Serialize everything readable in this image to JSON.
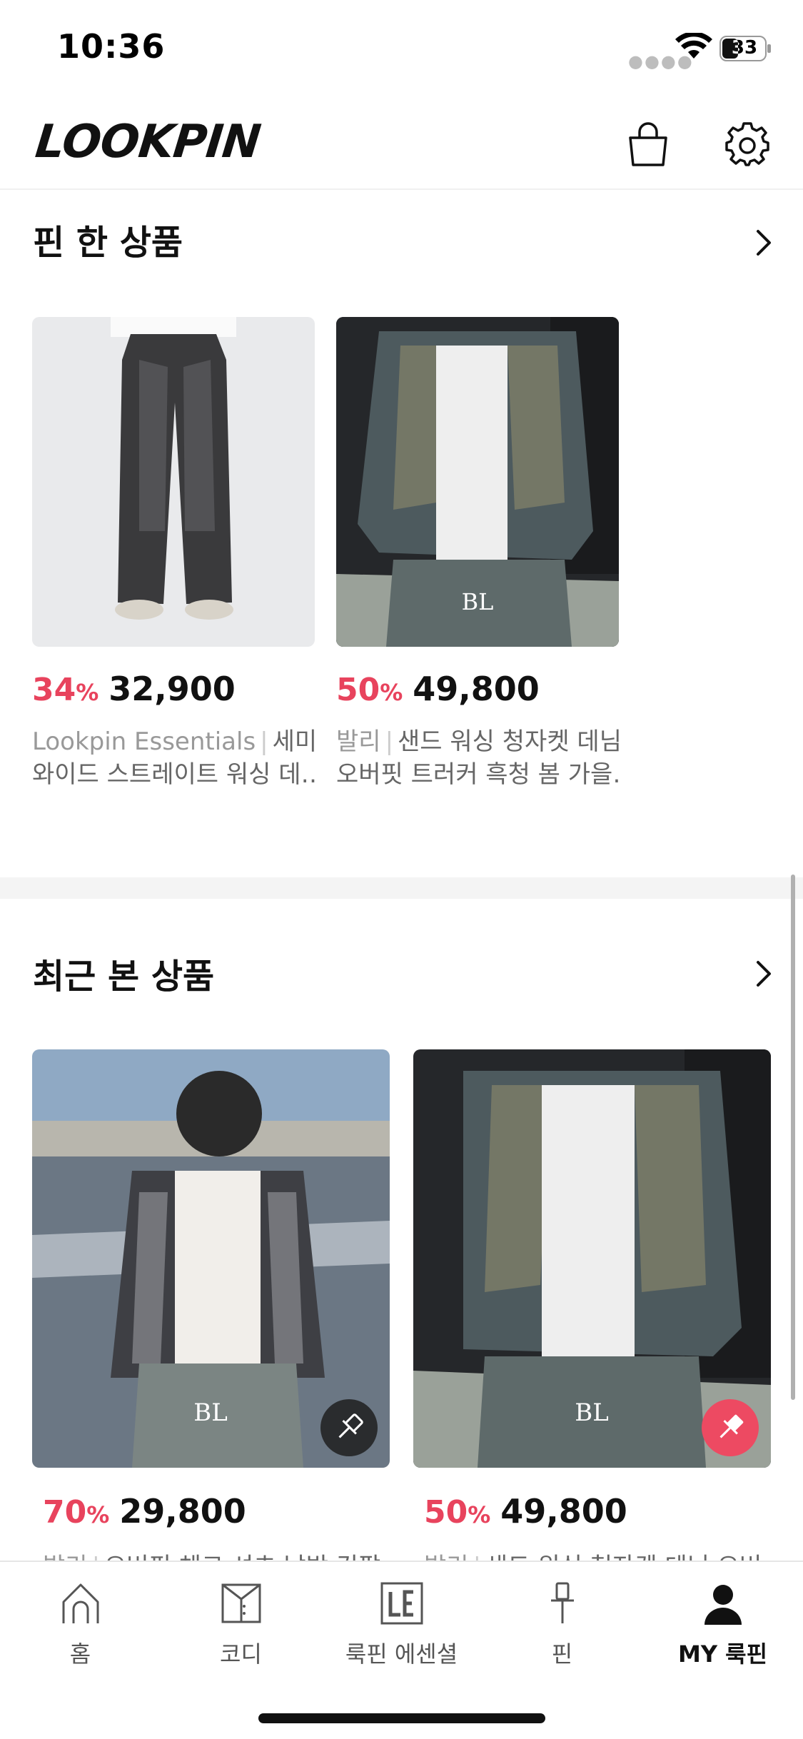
{
  "status_bar": {
    "time": "10:36",
    "battery": "33"
  },
  "header": {
    "logo": "LOOKPIN",
    "cart_icon": "shopping-bag-icon",
    "settings_icon": "gear-icon"
  },
  "pinned_section": {
    "title": "핀 한 상품",
    "items": [
      {
        "discount": "34",
        "pct": "%",
        "price": "32,900",
        "brand": "Lookpin Essentials",
        "name_line1": "세미",
        "name_line2": "와이드 스트레이트 워싱 데…"
      },
      {
        "discount": "50",
        "pct": "%",
        "price": "49,800",
        "brand": "발리",
        "name_line1": "샌드 워싱 청자켓 데님",
        "name_line2": "오버핏 트러커 흑청 봄 가을…"
      }
    ]
  },
  "recent_section": {
    "title": "최근 본 상품",
    "items": [
      {
        "discount": "70",
        "pct": "%",
        "price": "29,800",
        "brand": "발리",
        "name": "오버핏 체크 셔츠 남방 긴팔",
        "pinned": false
      },
      {
        "discount": "50",
        "pct": "%",
        "price": "49,800",
        "brand": "발리",
        "name": "샌드 워싱 청자켓 데님 오버",
        "pinned": true
      }
    ]
  },
  "tab_bar": {
    "tabs": [
      {
        "label": "홈",
        "icon": "home-icon",
        "active": false
      },
      {
        "label": "코디",
        "icon": "outfit-icon",
        "active": false
      },
      {
        "label": "룩핀 에센셜",
        "icon": "le-logo-icon",
        "active": false
      },
      {
        "label": "핀",
        "icon": "pin-icon",
        "active": false
      },
      {
        "label": "MY 룩핀",
        "icon": "profile-icon",
        "active": true
      }
    ]
  },
  "colors": {
    "accent": "#e8435d",
    "pin_active": "#ed4a62"
  }
}
